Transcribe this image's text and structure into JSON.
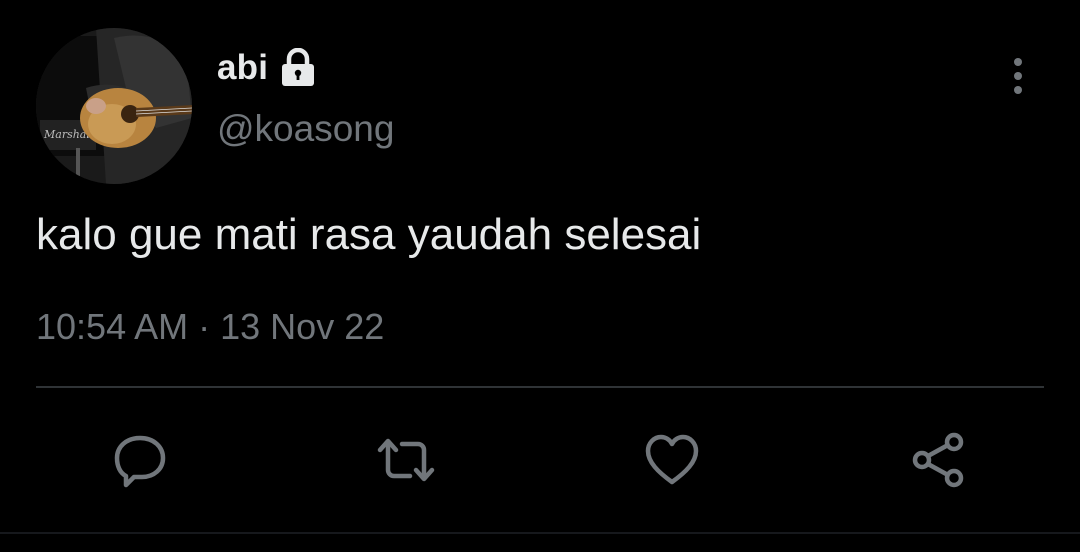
{
  "user": {
    "display_name": "abi",
    "handle": "@koasong",
    "protected_icon": "lock-icon"
  },
  "tweet": {
    "text": "kalo gue mati rasa yaudah selesai",
    "time": "10:54 AM",
    "separator": "·",
    "date": "13 Nov 22"
  },
  "actions": {
    "reply": "reply-icon",
    "retweet": "retweet-icon",
    "like": "heart-icon",
    "share": "share-icon",
    "more": "more-vertical-icon"
  },
  "colors": {
    "background": "#000000",
    "text_primary": "#e7e9ea",
    "text_secondary": "#71767b",
    "divider": "#2f3336"
  }
}
